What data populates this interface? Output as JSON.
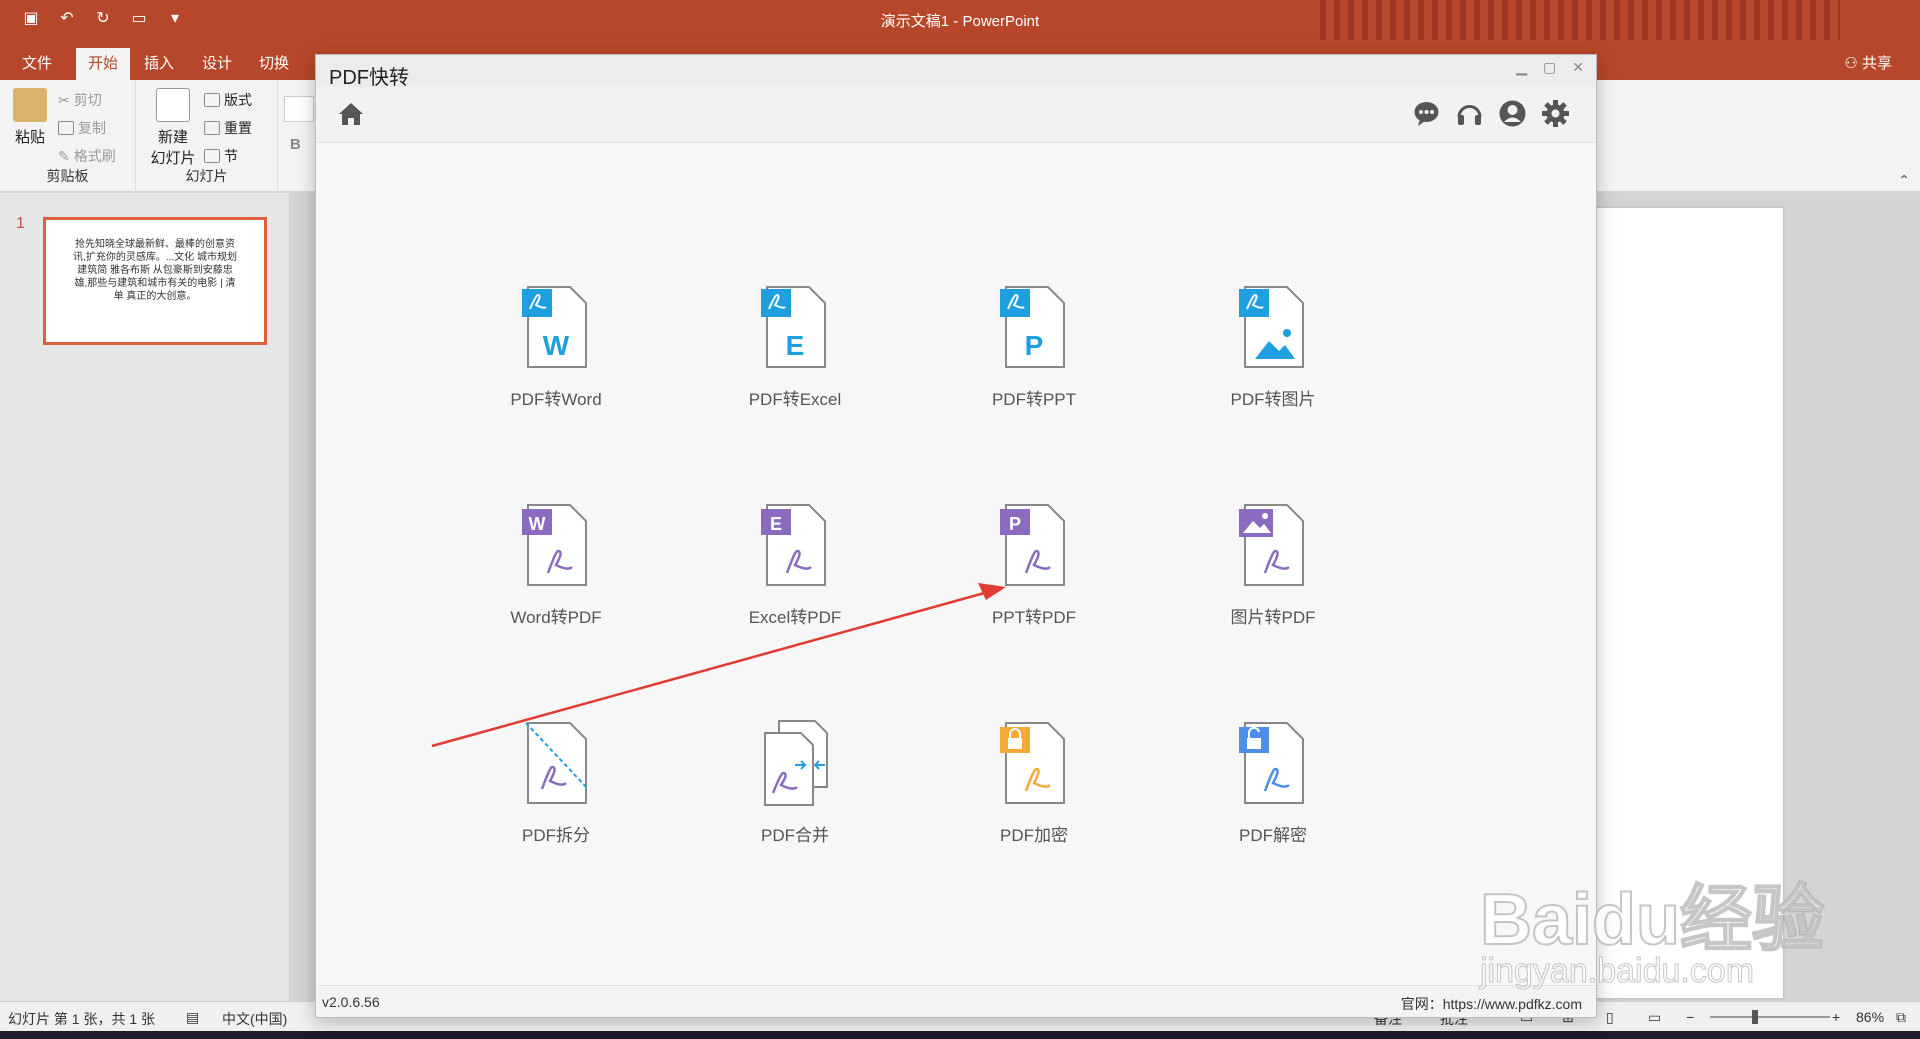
{
  "powerpoint": {
    "window_title": "演示文稿1 - PowerPoint",
    "tabs": [
      "文件",
      "开始",
      "插入",
      "设计",
      "切换"
    ],
    "active_tab": "开始",
    "share_label": "共享",
    "ribbon": {
      "paste": "粘贴",
      "cut": "剪切",
      "copy": "复制",
      "format_painter": "格式刷",
      "clipboard_group": "剪贴板",
      "new_slide_line1": "新建",
      "new_slide_line2": "幻灯片",
      "layout": "版式",
      "reset": "重置",
      "section": "节",
      "slides_group": "幻灯片",
      "bold": "B"
    },
    "thumbnail": {
      "number": "1",
      "text": "抢先知晓全球最新鲜、最棒的创意资讯,扩充你的灵感库。...文化 城市规划建筑简 雅各布斯 从包豪斯到安藤忠雄,那些与建筑和城市有关的电影 | 清单 真正的大创意。"
    },
    "status": {
      "slide_info": "幻灯片 第 1 张，共 1 张",
      "language": "中文(中国)",
      "notes": "备注",
      "comments": "批注",
      "zoom": "86%"
    }
  },
  "pdf_app": {
    "title": "PDF快转",
    "version": "v2.0.6.56",
    "website": "官网：https://www.pdfkz.com",
    "tools": [
      {
        "label": "PDF转Word",
        "letter": "W"
      },
      {
        "label": "PDF转Excel",
        "letter": "E"
      },
      {
        "label": "PDF转PPT",
        "letter": "P"
      },
      {
        "label": "PDF转图片",
        "letter": ""
      },
      {
        "label": "Word转PDF",
        "letter": "W"
      },
      {
        "label": "Excel转PDF",
        "letter": "E"
      },
      {
        "label": "PPT转PDF",
        "letter": "P"
      },
      {
        "label": "图片转PDF",
        "letter": ""
      },
      {
        "label": "PDF拆分",
        "letter": ""
      },
      {
        "label": "PDF合并",
        "letter": ""
      },
      {
        "label": "PDF加密",
        "letter": ""
      },
      {
        "label": "PDF解密",
        "letter": ""
      }
    ],
    "toolbar_icons": [
      "chat-icon",
      "headset-icon",
      "user-icon",
      "settings-icon"
    ]
  },
  "watermark": {
    "big": "Baidu经验",
    "small": "jingyan.baidu.com"
  },
  "colors": {
    "ppt_red": "#b7472a",
    "pdf_blue": "#1e9fe0",
    "doc_purple": "#8a6bbf",
    "lock_orange": "#f5a93a",
    "unlock_blue": "#4d8ee8",
    "arrow_red": "#e03c31"
  }
}
